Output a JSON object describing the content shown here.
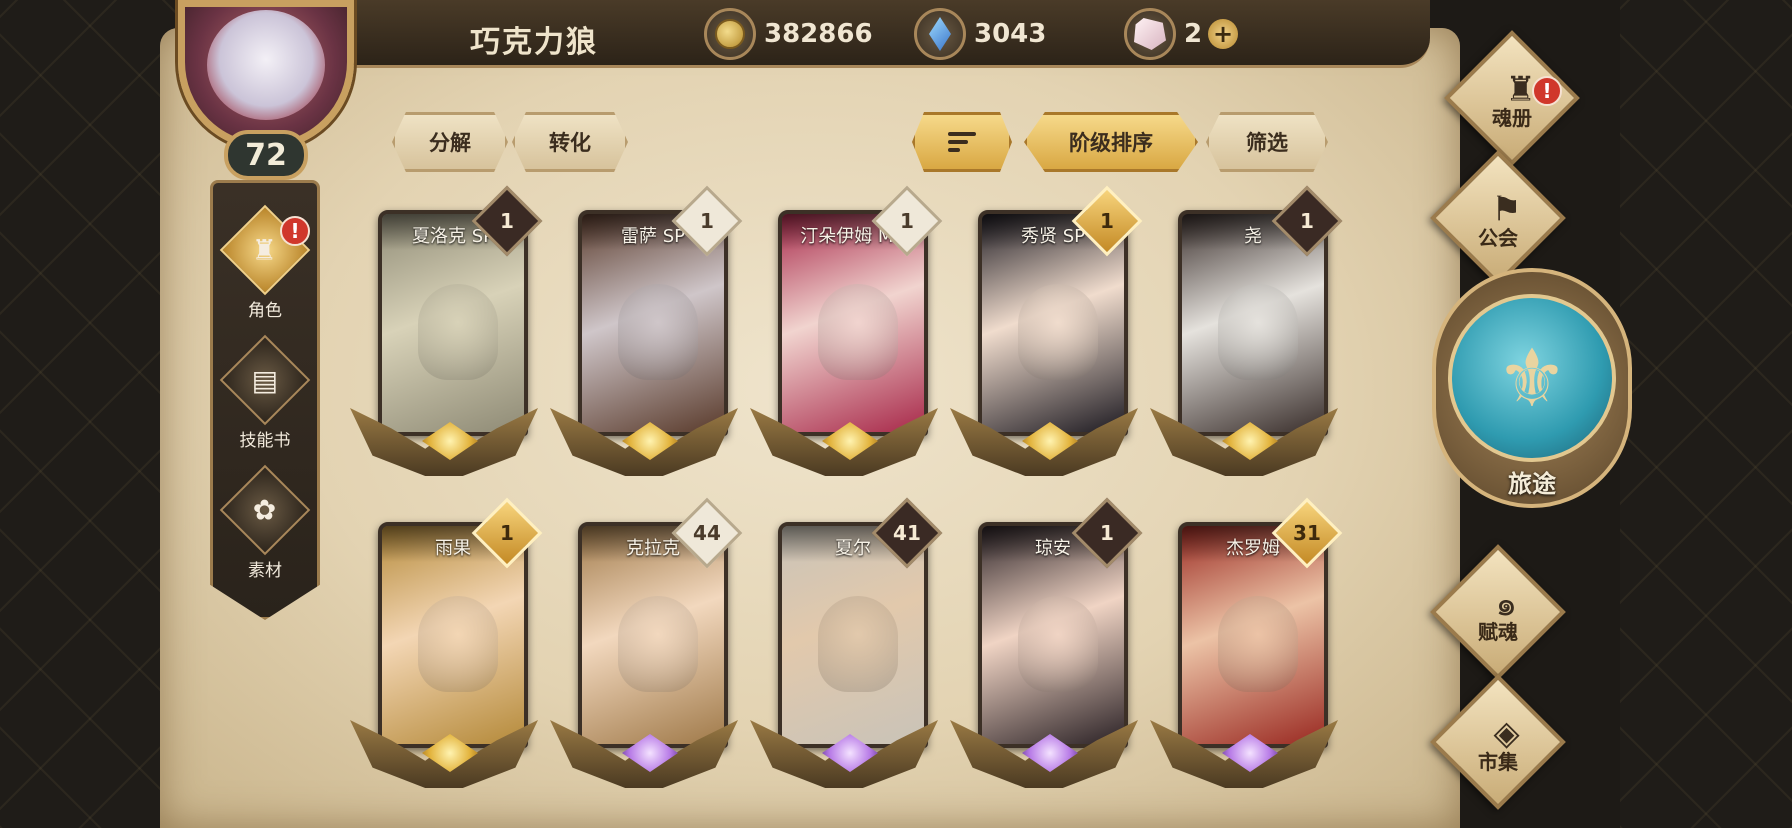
{
  "player": {
    "name": "巧克力狼",
    "level": "72"
  },
  "currencies": [
    {
      "icon": "gold-coin-icon",
      "value": "382866"
    },
    {
      "icon": "blue-gem-icon",
      "value": "3043"
    },
    {
      "icon": "soul-crystal-icon",
      "value": "2"
    }
  ],
  "left_nav": {
    "items": [
      {
        "label": "角色",
        "icon": "character-icon",
        "active": true,
        "alert": "!"
      },
      {
        "label": "技能书",
        "icon": "skill-book-icon",
        "active": false
      },
      {
        "label": "素材",
        "icon": "materials-icon",
        "active": false
      }
    ]
  },
  "toolbar": {
    "decompose": "分解",
    "convert": "转化",
    "sort_by_tier": "阶级排序",
    "filter": "筛选"
  },
  "cards": [
    {
      "name": "夏洛克 SP",
      "count": "1",
      "badge": "dark",
      "emblem": "gold",
      "colors": [
        "#d8d2b8",
        "#8f8b76"
      ]
    },
    {
      "name": "雷萨 SP",
      "count": "1",
      "badge": "light",
      "emblem": "gold",
      "colors": [
        "#cfc6c9",
        "#5a3b2c"
      ]
    },
    {
      "name": "汀朵伊姆 MZ",
      "count": "1",
      "badge": "light",
      "emblem": "gold",
      "colors": [
        "#f1d4cf",
        "#a8294a"
      ]
    },
    {
      "name": "秀贤 SP",
      "count": "1",
      "badge": "gold",
      "emblem": "gold",
      "colors": [
        "#f0dccd",
        "#1e1b22"
      ]
    },
    {
      "name": "尧",
      "count": "1",
      "badge": "dark",
      "emblem": "gold",
      "colors": [
        "#e5e2dd",
        "#3a2f2c"
      ]
    },
    {
      "name": "雨果",
      "count": "1",
      "badge": "gold",
      "emblem": "gold",
      "colors": [
        "#f3d6b4",
        "#b58a3a"
      ]
    },
    {
      "name": "克拉克",
      "count": "44",
      "badge": "light",
      "emblem": "purple",
      "colors": [
        "#f2d8be",
        "#a07a4a"
      ]
    },
    {
      "name": "夏尔",
      "count": "41",
      "badge": "dark",
      "emblem": "purple",
      "colors": [
        "#e2c9ac",
        "#c9c3b8"
      ]
    },
    {
      "name": "琼安",
      "count": "1",
      "badge": "dark",
      "emblem": "purple",
      "colors": [
        "#f0d4c4",
        "#2b2226"
      ]
    },
    {
      "name": "杰罗姆",
      "count": "31",
      "badge": "gold",
      "emblem": "purple",
      "colors": [
        "#ecc3a6",
        "#9a2a22"
      ]
    }
  ],
  "right_nav": {
    "soul_book": "魂册",
    "soul_book_alert": "!",
    "guild": "公会",
    "journey": "旅途",
    "endow_soul": "赋魂",
    "market": "市集"
  }
}
